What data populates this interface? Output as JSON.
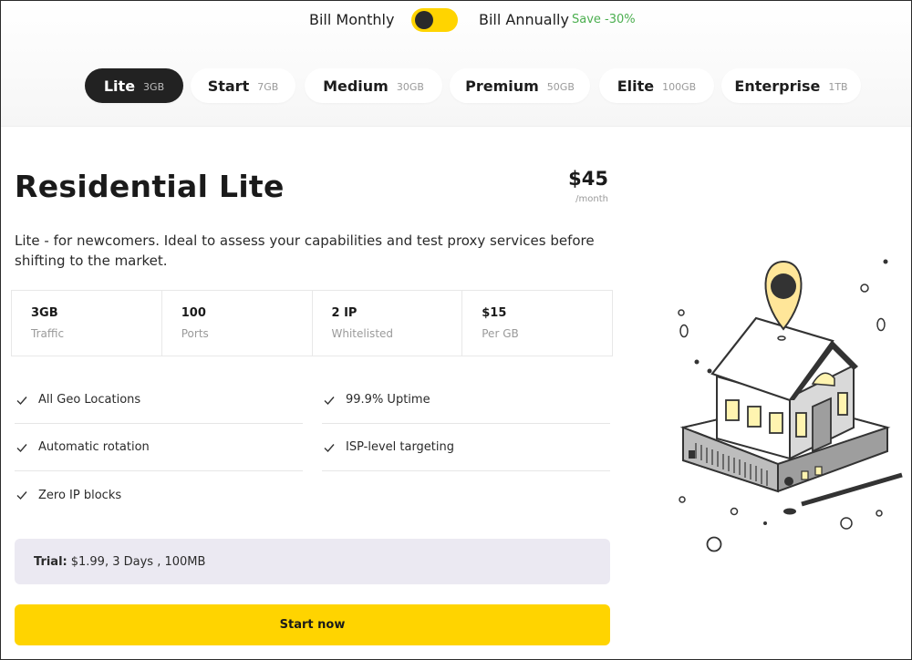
{
  "billing": {
    "monthly_label": "Bill Monthly",
    "annually_label": "Bill Annually",
    "save_badge": "Save -30%",
    "accent_color": "#ffd400"
  },
  "tabs": [
    {
      "name": "Lite",
      "size": "3GB",
      "active": true
    },
    {
      "name": "Start",
      "size": "7GB",
      "active": false
    },
    {
      "name": "Medium",
      "size": "30GB",
      "active": false
    },
    {
      "name": "Premium",
      "size": "50GB",
      "active": false
    },
    {
      "name": "Elite",
      "size": "100GB",
      "active": false
    },
    {
      "name": "Enterprise",
      "size": "1TB",
      "active": false
    }
  ],
  "plan": {
    "title": "Residential Lite",
    "price": "$45",
    "period": "/month",
    "description": "Lite - for newcomers. Ideal to assess your capabilities and test proxy services before shifting to the market."
  },
  "stats": [
    {
      "value": "3GB",
      "label": "Traffic"
    },
    {
      "value": "100",
      "label": "Ports"
    },
    {
      "value": "2 IP",
      "label": "Whitelisted"
    },
    {
      "value": "$15",
      "label": "Per GB"
    }
  ],
  "features": [
    {
      "label": "All Geo Locations",
      "icon": "check-icon"
    },
    {
      "label": "99.9% Uptime",
      "icon": "check-icon"
    },
    {
      "label": "Automatic rotation",
      "icon": "check-icon"
    },
    {
      "label": "ISP-level targeting",
      "icon": "check-icon"
    },
    {
      "label": "Zero IP blocks",
      "icon": "check-icon"
    }
  ],
  "trial": {
    "key": "Trial:",
    "value": "$1.99, 3 Days , 100MB"
  },
  "cta": {
    "label": "Start now"
  },
  "illustration": {
    "icon": "house-location-pin-illustration"
  }
}
